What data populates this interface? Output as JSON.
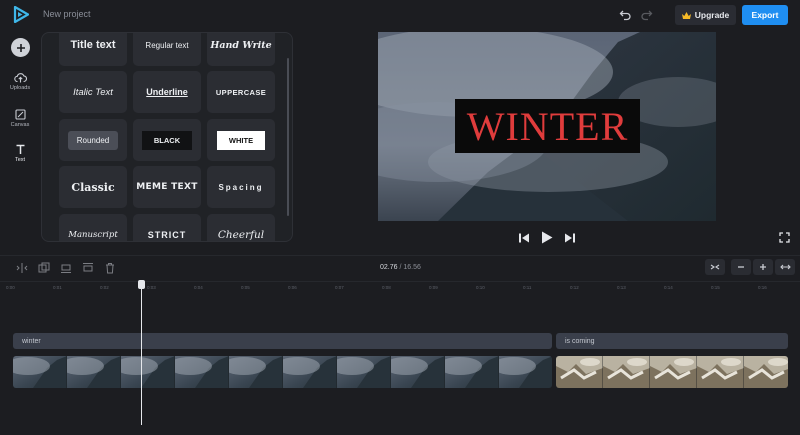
{
  "app": {
    "project_name": "New project"
  },
  "toolbar": {
    "upgrade_label": "Upgrade",
    "export_label": "Export"
  },
  "sidebar": {
    "items": [
      {
        "label": "Uploads",
        "icon": "upload-cloud-icon"
      },
      {
        "label": "Canvas",
        "icon": "canvas-icon"
      },
      {
        "label": "Text",
        "icon": "text-icon"
      }
    ]
  },
  "text_styles": [
    "Title text",
    "Regular text",
    "Hand Write",
    "Italic Text",
    "Underline",
    "UPPERCASE",
    "Rounded",
    "BLACK",
    "WHITE",
    "Classic",
    "MEME TEXT",
    "Spacing",
    "Manuscript",
    "STRICT",
    "Cheerful"
  ],
  "preview": {
    "overlay_text": "WINTER",
    "overlay_color": "#e03c3c"
  },
  "timeline": {
    "current_time": "02.76",
    "separator": "/",
    "total_time": "16.56",
    "ruler_ticks": [
      "0:00",
      "0:01",
      "0:02",
      "0:03",
      "0:04",
      "0:05",
      "0:06",
      "0:07",
      "0:08",
      "0:09",
      "0:10",
      "0:11",
      "0:12",
      "0:13",
      "0:14",
      "0:15",
      "0:16"
    ],
    "caption_clips": [
      "winter",
      "is coming"
    ]
  },
  "colors": {
    "accent": "#1f8ef1",
    "background": "#1c1d21"
  }
}
